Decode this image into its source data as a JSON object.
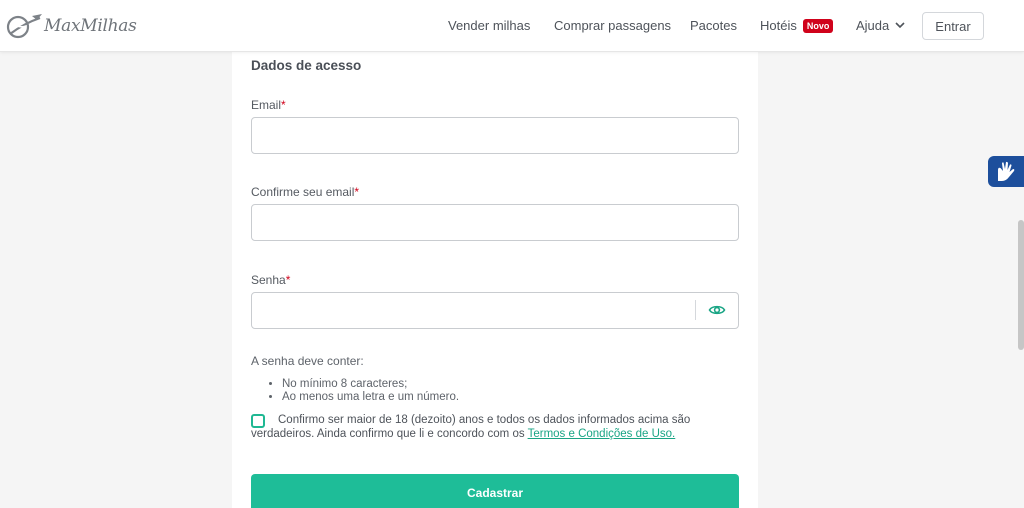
{
  "header": {
    "logo_text": "MaxMilhas",
    "nav": {
      "sell_miles": "Vender milhas",
      "buy_tickets": "Comprar passagens",
      "packages": "Pacotes",
      "hotels": "Hotéis",
      "hotels_badge": "Novo",
      "help": "Ajuda"
    },
    "login_label": "Entrar"
  },
  "form": {
    "section_title": "Dados de acesso",
    "email_label": "Email",
    "email_value": "",
    "confirm_email_label": "Confirme seu email",
    "confirm_email_value": "",
    "password_label": "Senha",
    "password_value": "",
    "required_mark": "*",
    "password_hint": "A senha deve conter:",
    "password_rules": [
      "No mínimo 8 caracteres;",
      "Ao menos uma letra e um número."
    ],
    "terms_text": "Confirmo ser maior de 18 (dezoito) anos e todos os dados informados acima são verdadeiros. Ainda confirmo que li e concordo com os ",
    "terms_link": "Termos e Condições de Uso.",
    "terms_checked": false,
    "submit_label": "Cadastrar"
  },
  "colors": {
    "accent": "#1ebd98",
    "badge": "#d0021b",
    "a11y_button": "#1d4f9c"
  },
  "icons": [
    "plane-logo-icon",
    "chevron-down-icon",
    "eye-icon",
    "sign-language-icon"
  ]
}
